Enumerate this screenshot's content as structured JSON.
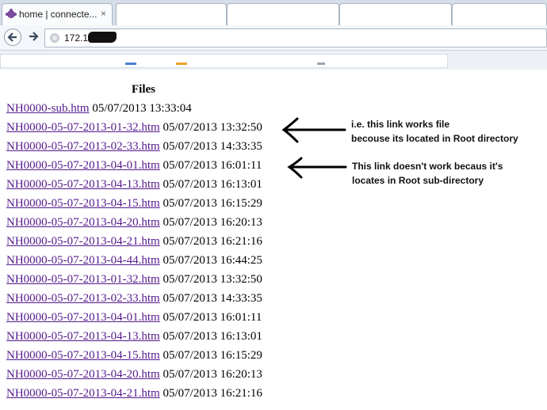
{
  "browser": {
    "tab": {
      "title": "home | connecte...",
      "close": "×"
    },
    "address": {
      "value": "172.16."
    }
  },
  "page": {
    "heading": "Files",
    "rows": [
      {
        "link": "NH0000-sub.htm",
        "date": " 05/07/2013 13:33:04"
      },
      {
        "link": "NH0000-05-07-2013-01-32.htm",
        "date": " 05/07/2013 13:32:50"
      },
      {
        "link": "NH0000-05-07-2013-02-33.htm",
        "date": " 05/07/2013 14:33:35"
      },
      {
        "link": "NH0000-05-07-2013-04-01.htm",
        "date": " 05/07/2013 16:01:11"
      },
      {
        "link": "NH0000-05-07-2013-04-13.htm",
        "date": " 05/07/2013 16:13:01"
      },
      {
        "link": "NH0000-05-07-2013-04-15.htm",
        "date": " 05/07/2013 16:15:29"
      },
      {
        "link": "NH0000-05-07-2013-04-20.htm",
        "date": " 05/07/2013 16:20:13"
      },
      {
        "link": "NH0000-05-07-2013-04-21.htm",
        "date": " 05/07/2013 16:21:16"
      },
      {
        "link": "NH0000-05-07-2013-04-44.htm",
        "date": " 05/07/2013 16:44:25"
      },
      {
        "link": "NH0000-05-07-2013-01-32.htm",
        "date": " 05/07/2013 13:32:50"
      },
      {
        "link": "NH0000-05-07-2013-02-33.htm",
        "date": " 05/07/2013 14:33:35"
      },
      {
        "link": "NH0000-05-07-2013-04-01.htm",
        "date": " 05/07/2013 16:01:11"
      },
      {
        "link": "NH0000-05-07-2013-04-13.htm",
        "date": " 05/07/2013 16:13:01"
      },
      {
        "link": "NH0000-05-07-2013-04-15.htm",
        "date": " 05/07/2013 16:15:29"
      },
      {
        "link": "NH0000-05-07-2013-04-20.htm",
        "date": " 05/07/2013 16:20:13"
      },
      {
        "link": "NH0000-05-07-2013-04-21.htm",
        "date": " 05/07/2013 16:21:16"
      }
    ]
  },
  "annotations": {
    "note1": {
      "line1": "i.e. this link works file",
      "line2": "becouse its located in Root directory"
    },
    "note2": {
      "line1": "This link doesn't work becaus it's",
      "line2": "locates in Root sub-directory"
    }
  },
  "icons": {
    "favicon": "puzzle-icon",
    "back": "back-arrow-icon",
    "forward": "forward-arrow-icon",
    "globe": "globe-icon"
  },
  "colors": {
    "link": "#551a8b",
    "annotation_arrow": "#000000"
  }
}
